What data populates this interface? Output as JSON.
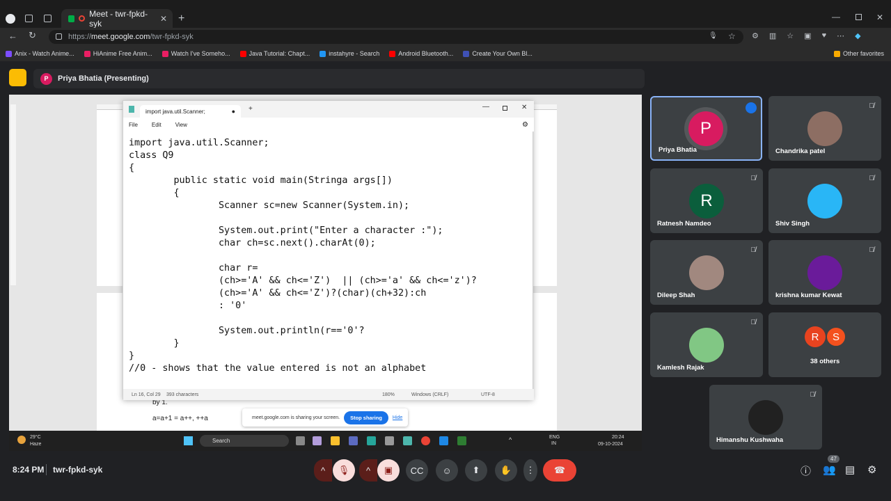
{
  "browser": {
    "tab_title": "Meet - twr-fpkd-syk",
    "url_prefix": "https://",
    "url_main": "meet.google.com",
    "url_path": "/twr-fpkd-syk",
    "bookmarks": [
      {
        "label": "Anix - Watch Anime...",
        "color": "#7c4dff"
      },
      {
        "label": "HiAnime Free Anim...",
        "color": "#e91e63"
      },
      {
        "label": "Watch I've Someho...",
        "color": "#e91e63"
      },
      {
        "label": "Java Tutorial: Chapt...",
        "color": "#ff0000"
      },
      {
        "label": "instahyre - Search",
        "color": "#2196f3"
      },
      {
        "label": "Android Bluetooth...",
        "color": "#ff0000"
      },
      {
        "label": "Create Your Own Bl...",
        "color": "#3f51b5"
      }
    ],
    "other_favorites": "Other favorites"
  },
  "presenter": {
    "avatar_letter": "P",
    "label": "Priya Bhatia (Presenting)"
  },
  "notepad": {
    "tab_title": "import java.util.Scanner;",
    "menu": [
      "File",
      "Edit",
      "View"
    ],
    "code_lines": [
      "import java.util.Scanner;",
      "class Q9",
      "{",
      "        public static void main(Stringa args[])",
      "        {",
      "                Scanner sc=new Scanner(System.in);",
      "",
      "                System.out.print(\"Enter a character :\");",
      "                char ch=sc.next().charAt(0);",
      "",
      "                char r=",
      "                (ch>='A' && ch<='Z')  || (ch>='a' && ch<='z')?",
      "                (ch>='A' && ch<='Z')?(char)(ch+32):ch",
      "                : '0'",
      "",
      "                System.out.println(r=='0'?",
      "        }",
      "}",
      "//0 - shows that the value entered is not an alphabet"
    ],
    "status": {
      "position": "Ln 16, Col 29",
      "chars": "393 characters",
      "zoom": "180%",
      "line_ending": "Windows (CRLF)",
      "encoding": "UTF-8"
    }
  },
  "doc": {
    "line1": "by 1.",
    "line2": "a=a+1 = a++, ++a"
  },
  "share_banner": {
    "text": "meet.google.com is sharing your screen.",
    "stop": "Stop sharing",
    "hide": "Hide"
  },
  "taskbar": {
    "weather_temp": "29°C",
    "weather_desc": "Haze",
    "search": "Search",
    "lang1": "ENG",
    "lang2": "IN",
    "time": "20:24",
    "date": "09-10-2024"
  },
  "participants": [
    {
      "name": "Priya Bhatia",
      "letter": "P",
      "color": "#d81b60"
    },
    {
      "name": "Chandrika patel",
      "letter": "",
      "color": "#8d6e63"
    },
    {
      "name": "Ratnesh Namdeo",
      "letter": "R",
      "color": "#0b5e3c"
    },
    {
      "name": "Shiv Singh",
      "letter": "",
      "color": "#29b6f6"
    },
    {
      "name": "Dileep Shah",
      "letter": "",
      "color": "#a1887f"
    },
    {
      "name": "krishna kumar Kewat",
      "letter": "",
      "color": "#6a1b9a"
    },
    {
      "name": "Kamlesh Rajak",
      "letter": "",
      "color": "#81c784"
    },
    {
      "name": "38 others",
      "letter": "",
      "color": ""
    },
    {
      "name": "Himanshu Kushwaha",
      "letter": "",
      "color": "#212121"
    }
  ],
  "others_avatars": [
    "R",
    "S"
  ],
  "meeting": {
    "time": "8:24 PM",
    "code": "twr-fpkd-syk",
    "people_count": "47"
  }
}
